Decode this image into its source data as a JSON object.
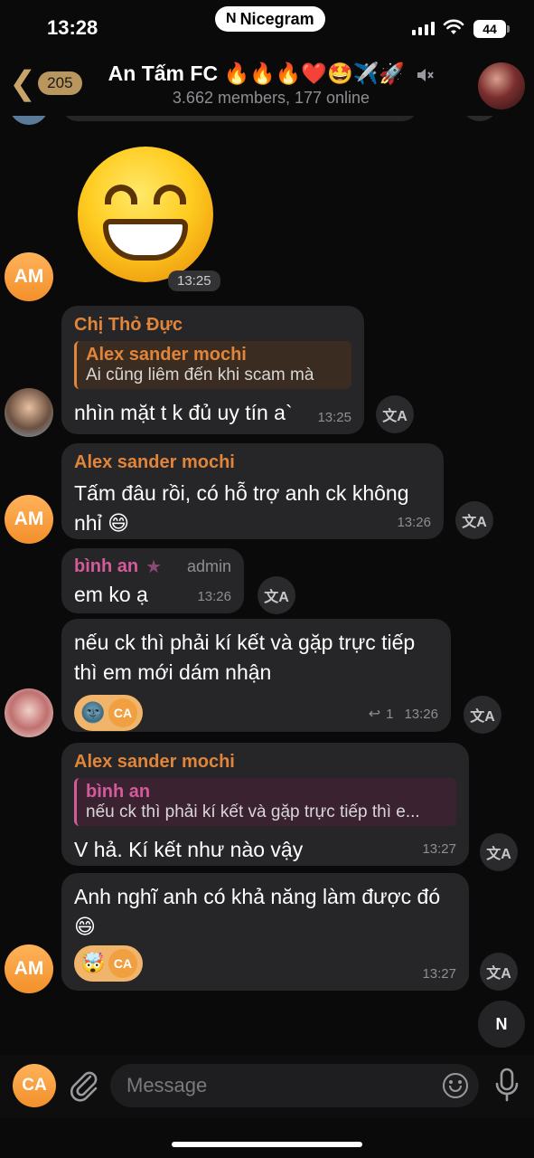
{
  "status_bar": {
    "time": "13:28",
    "app_pill": "Nicegram",
    "battery": "44"
  },
  "header": {
    "back_count": "205",
    "title": "An Tấm FC 🔥🔥🔥❤️🤩✈️🚀",
    "subtitle": "3.662 members, 177 online",
    "muted": true
  },
  "messages": [
    {
      "type": "sticker",
      "avatar": "AM",
      "time": "13:25"
    },
    {
      "sender": "Chị Thỏ Đực",
      "reply_name": "Alex sander mochi",
      "reply_text": "Ai cũng liêm đến khi scam mà",
      "text": "nhìn mặt t k đủ uy tín a`",
      "time": "13:25"
    },
    {
      "sender": "Alex sander mochi",
      "avatar": "AM",
      "text": "Tấm đâu rồi, có hỗ trợ anh ck không nhỉ 😄",
      "time": "13:26"
    },
    {
      "sender": "bình an",
      "badge": "admin",
      "text": "em ko ạ",
      "time": "13:26"
    },
    {
      "text": "nếu ck thì phải kí kết và gặp trực tiếp thì em mới dám nhận",
      "reactions": [
        "🌚",
        "CA"
      ],
      "reply_count": "1",
      "time": "13:26"
    },
    {
      "sender": "Alex sander mochi",
      "reply_name": "bình an",
      "reply_text": "nếu ck thì phải kí kết và gặp trực tiếp thì e...",
      "text": "V hả. Kí kết như nào vậy",
      "time": "13:27"
    },
    {
      "avatar": "AM",
      "text": "Anh nghĩ anh có khả năng làm được đó 😄",
      "reactions": [
        "🤯",
        "CA"
      ],
      "time": "13:27"
    }
  ],
  "input": {
    "avatar": "CA",
    "placeholder": "Message"
  },
  "colors": {
    "accent_orange": "#e0853a",
    "accent_pink": "#d45b9a",
    "bubble": "#262628",
    "background": "#0a0a0a"
  }
}
